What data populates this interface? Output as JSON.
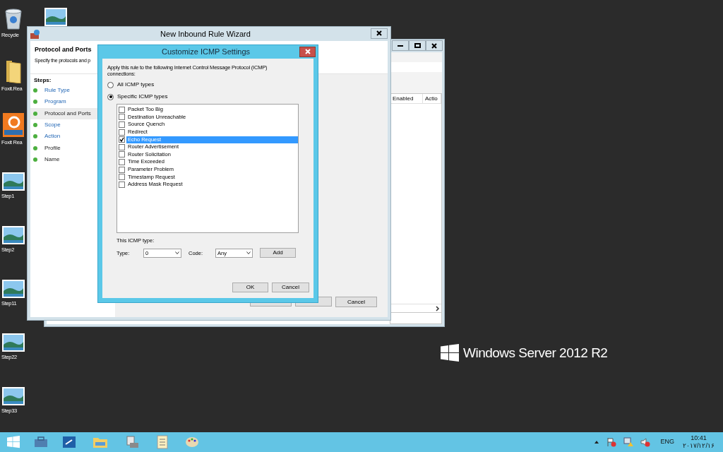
{
  "desktop_icons": [
    {
      "label": "Recycle",
      "kind": "bin"
    },
    {
      "label": "Foxit.Rea",
      "kind": "folder"
    },
    {
      "label": "Foxit Rea",
      "kind": "pdf"
    },
    {
      "label": "Step1",
      "kind": "image"
    },
    {
      "label": "Step2",
      "kind": "image"
    },
    {
      "label": "Step11",
      "kind": "image"
    },
    {
      "label": "Step22",
      "kind": "image"
    },
    {
      "label": "Step33",
      "kind": "image"
    }
  ],
  "background_window": {
    "columns": [
      "Enabled",
      "Actio"
    ]
  },
  "wizard": {
    "title": "New Inbound Rule Wizard",
    "heading": "Protocol and Ports",
    "subheading": "Specify the protocols and p",
    "steps_label": "Steps:",
    "steps": [
      {
        "label": "Rule Type",
        "selected": false,
        "link": true
      },
      {
        "label": "Program",
        "selected": false,
        "link": true
      },
      {
        "label": "Protocol and Ports",
        "selected": true,
        "link": false
      },
      {
        "label": "Scope",
        "selected": false,
        "link": true
      },
      {
        "label": "Action",
        "selected": false,
        "link": true
      },
      {
        "label": "Profile",
        "selected": false,
        "link": false
      },
      {
        "label": "Name",
        "selected": false,
        "link": false
      }
    ],
    "cancel_button": "Cancel"
  },
  "dialog": {
    "title": "Customize ICMP Settings",
    "intro": "Apply this rule to the following Internet Control Message Protocol (ICMP) connections:",
    "options": [
      {
        "label": "All ICMP types",
        "selected": false
      },
      {
        "label": "Specific ICMP types",
        "selected": true
      }
    ],
    "icmp_types": [
      {
        "label": "Packet Too Big",
        "checked": false,
        "selected": false
      },
      {
        "label": "Destination Unreachable",
        "checked": false,
        "selected": false
      },
      {
        "label": "Source Quench",
        "checked": false,
        "selected": false
      },
      {
        "label": "Redirect",
        "checked": false,
        "selected": false
      },
      {
        "label": "Echo Request",
        "checked": true,
        "selected": true
      },
      {
        "label": "Router Advertisement",
        "checked": false,
        "selected": false
      },
      {
        "label": "Router Solicitation",
        "checked": false,
        "selected": false
      },
      {
        "label": "Time Exceeded",
        "checked": false,
        "selected": false
      },
      {
        "label": "Parameter Problem",
        "checked": false,
        "selected": false
      },
      {
        "label": "Timestamp Request",
        "checked": false,
        "selected": false
      },
      {
        "label": "Address Mask Request",
        "checked": false,
        "selected": false
      }
    ],
    "this_type_label": "This ICMP type:",
    "type_label": "Type:",
    "type_value": "0",
    "code_label": "Code:",
    "code_value": "Any",
    "add_button": "Add",
    "ok_button": "OK",
    "cancel_button": "Cancel"
  },
  "branding": {
    "logo_text": "Windows Server 2012 R2"
  },
  "taskbar": {
    "language": "ENG",
    "time": "10:41",
    "date": "۲۰۱۷/۱۲/۱۶"
  }
}
